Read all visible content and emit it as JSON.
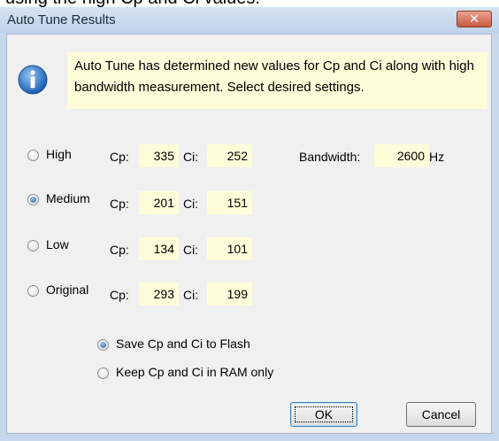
{
  "window": {
    "title": "Auto Tune Results",
    "close_label": "✕"
  },
  "message": {
    "text": "Auto Tune has determined new values for Cp and Ci along with high bandwidth measurement.  Select desired settings.",
    "icon": "info-icon"
  },
  "cp_label": "Cp:",
  "ci_label": "Ci:",
  "options": [
    {
      "label": "High",
      "cp": "335",
      "ci": "252",
      "checked": false
    },
    {
      "label": "Medium",
      "cp": "201",
      "ci": "151",
      "checked": true
    },
    {
      "label": "Low",
      "cp": "134",
      "ci": "101",
      "checked": false
    },
    {
      "label": "Original",
      "cp": "293",
      "ci": "199",
      "checked": false
    }
  ],
  "bandwidth": {
    "label": "Bandwidth:",
    "value": "2600",
    "unit": "Hz"
  },
  "save_options": [
    {
      "label": "Save Cp and Ci to Flash",
      "checked": true
    },
    {
      "label": "Keep Cp and Ci in RAM only",
      "checked": false
    }
  ],
  "buttons": {
    "ok": "OK",
    "cancel": "Cancel"
  },
  "background_fragment": "using the high Cp and Ci values."
}
